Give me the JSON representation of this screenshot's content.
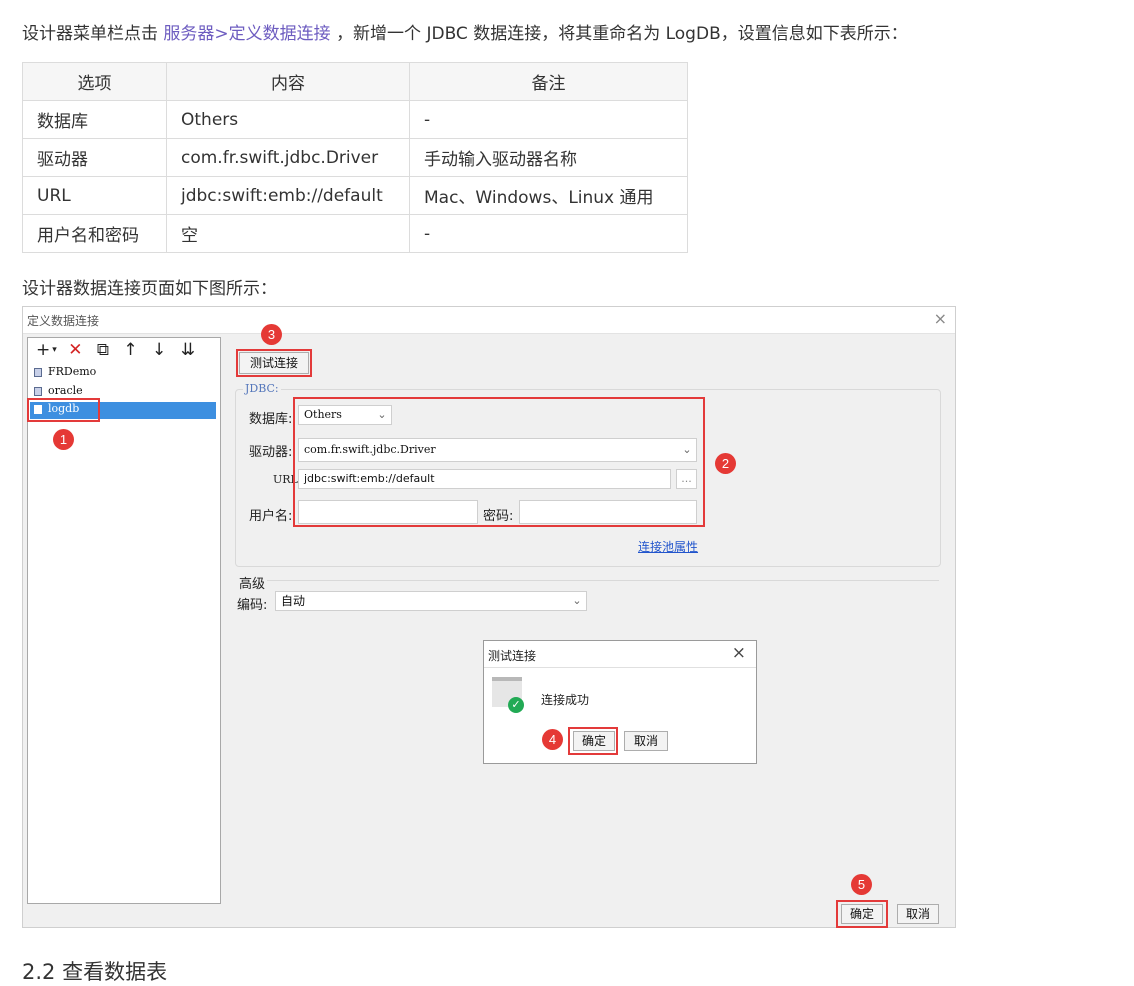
{
  "intro": {
    "prefix": "设计器菜单栏点击",
    "menu_path": "服务器>定义数据连接",
    "suffix": "，新增一个 JDBC 数据连接，将其重命名为 LogDB，设置信息如下表所示："
  },
  "table": {
    "headers": [
      "选项",
      "内容",
      "备注"
    ],
    "rows": [
      [
        "数据库",
        "Others",
        "-"
      ],
      [
        "驱动器",
        "com.fr.swift.jdbc.Driver",
        "手动输入驱动器名称"
      ],
      [
        "URL",
        "jdbc:swift:emb://default",
        "Mac、Windows、Linux 通用"
      ],
      [
        "用户名和密码",
        "空",
        "-"
      ]
    ]
  },
  "caption": "设计器数据连接页面如下图所示：",
  "dialog": {
    "title": "定义数据连接",
    "close": "×",
    "toolbar_icons": [
      "add-icon",
      "delete-icon",
      "copy-icon",
      "move-up-icon",
      "move-down-icon",
      "sort-icon"
    ],
    "connections": [
      "FRDemo",
      "oracle",
      "logdb"
    ],
    "selected_connection": "logdb",
    "test_button": "测试连接",
    "jdbc_label": "JDBC:",
    "database_label": "数据库:",
    "database_value": "Others",
    "driver_label": "驱动器:",
    "driver_value": "com.fr.swift.jdbc.Driver",
    "url_label": "URL:",
    "url_value": "jdbc:swift:emb://default",
    "url_browse": "...",
    "username_label": "用户名:",
    "username_value": "",
    "password_label": "密码:",
    "password_value": "",
    "pool_link": "连接池属性",
    "advanced_label": "高级",
    "encoding_label": "编码:",
    "encoding_value": "自动",
    "ok_button": "确定",
    "cancel_button": "取消"
  },
  "popup": {
    "title": "测试连接",
    "close": "×",
    "message": "连接成功",
    "ok_button": "确定",
    "cancel_button": "取消"
  },
  "badges": [
    "1",
    "2",
    "3",
    "4",
    "5"
  ],
  "section_heading": "2.2 查看数据表",
  "colors": {
    "accent_red": "#e33a3a",
    "link_purple": "#6d5cc0",
    "selection_blue": "#3d8fe0",
    "success_green": "#22aa55"
  }
}
